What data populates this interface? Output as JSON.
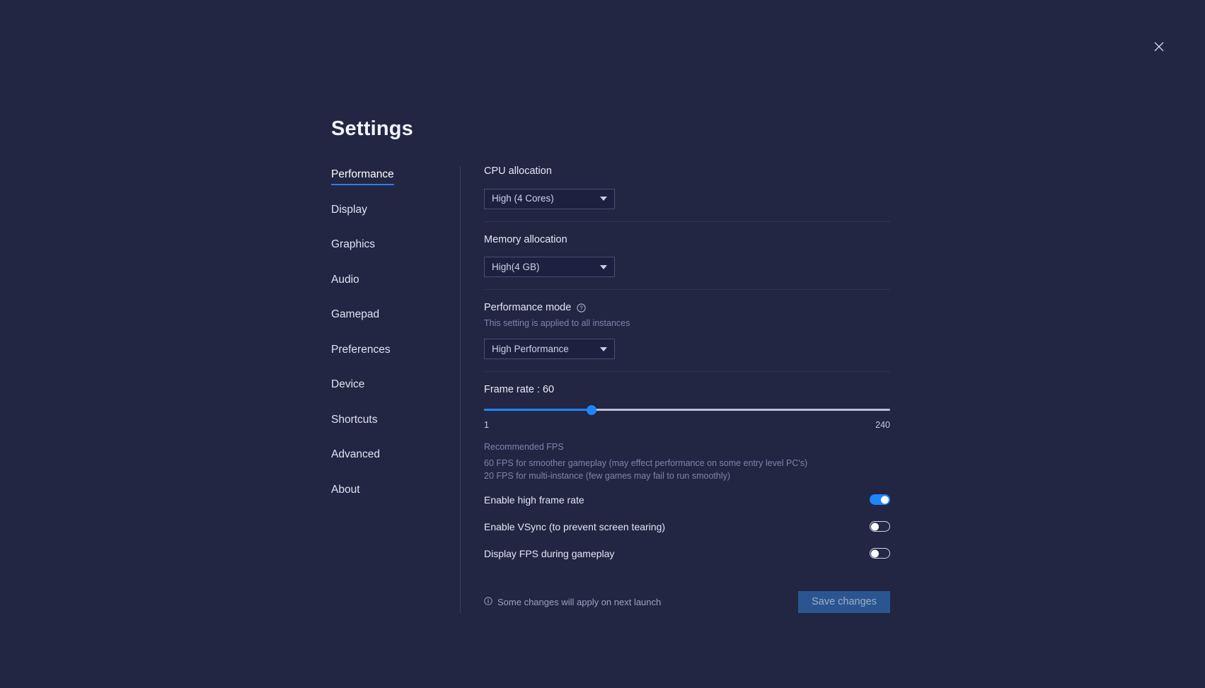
{
  "window": {
    "close_label": "Close",
    "close_icon": "close-icon"
  },
  "page_title": "Settings",
  "sidebar": {
    "items": [
      {
        "label": "Performance",
        "active": true
      },
      {
        "label": "Display",
        "active": false
      },
      {
        "label": "Graphics",
        "active": false
      },
      {
        "label": "Audio",
        "active": false
      },
      {
        "label": "Gamepad",
        "active": false
      },
      {
        "label": "Preferences",
        "active": false
      },
      {
        "label": "Device",
        "active": false
      },
      {
        "label": "Shortcuts",
        "active": false
      },
      {
        "label": "Advanced",
        "active": false
      },
      {
        "label": "About",
        "active": false
      }
    ]
  },
  "content": {
    "cpu": {
      "label": "CPU allocation",
      "value": "High (4 Cores)"
    },
    "memory": {
      "label": "Memory allocation",
      "value": "High(4 GB)"
    },
    "performance_mode": {
      "label": "Performance mode",
      "help_icon": "question-circle-icon",
      "description": "This setting is applied to all instances",
      "value": "High Performance"
    },
    "frame_rate": {
      "label": "Frame rate : 60",
      "value": 60,
      "min_label": "1",
      "max_label": "240",
      "min": 1,
      "max": 240,
      "recommended_title": "Recommended FPS",
      "recommended_desc": "60 FPS for smoother gameplay (may effect performance on some entry level PC's) 20 FPS for multi-instance (few games may fail to run smoothly)"
    },
    "toggles": [
      {
        "label": "Enable high frame rate",
        "on": true
      },
      {
        "label": "Enable VSync (to prevent screen tearing)",
        "on": false
      },
      {
        "label": "Display FPS during gameplay",
        "on": false
      }
    ],
    "footer": {
      "note_icon": "info-icon",
      "note": "Some changes will apply on next launch",
      "save_label": "Save changes"
    }
  },
  "colors": {
    "background": "#222642",
    "accent": "#1e85ff",
    "active_underline": "#2b7ee8",
    "save_button": "#2a5590",
    "muted_text": "#7e85ad"
  }
}
